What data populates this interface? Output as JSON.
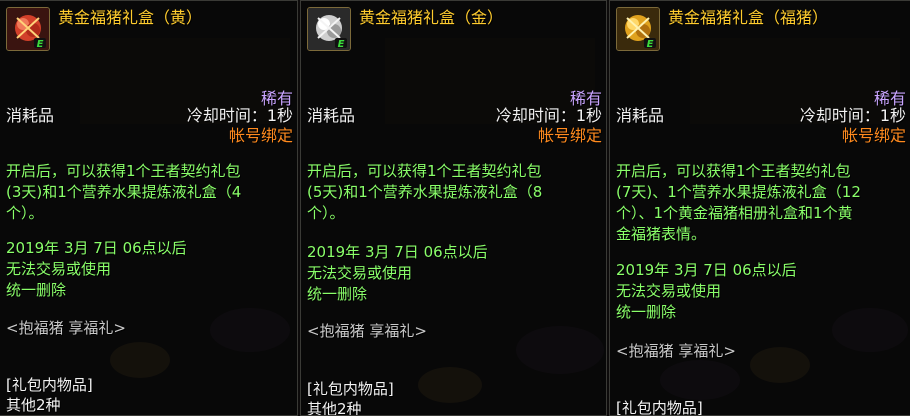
{
  "tooltips": [
    {
      "title": "黄金福猪礼盒（黄）",
      "icon": "gold-pig-gift-box-red-icon",
      "rarity": "稀有",
      "item_type": "消耗品",
      "cooldown": "冷却时间：1秒",
      "binding": "帐号绑定",
      "description_lines": [
        "开启后，可以获得1个王者契约礼包",
        "(3天)和1个营养水果提炼液礼盒（4",
        "个）。"
      ],
      "date_line": "2019年 3月 7日 06点以后",
      "trade_line": "无法交易或使用",
      "delete_line": "统一删除",
      "motto": "<抱福猪 享福礼>",
      "contents_heading": "[礼包内物品]",
      "contents_more": "其他2种"
    },
    {
      "title": "黄金福猪礼盒（金）",
      "icon": "gold-pig-gift-box-silver-icon",
      "rarity": "稀有",
      "item_type": "消耗品",
      "cooldown": "冷却时间：1秒",
      "binding": "帐号绑定",
      "description_lines": [
        "开启后，可以获得1个王者契约礼包",
        "(5天)和1个营养水果提炼液礼盒（8",
        "个）。"
      ],
      "date_line": "2019年 3月 7日 06点以后",
      "trade_line": "无法交易或使用",
      "delete_line": "统一删除",
      "motto": "<抱福猪 享福礼>",
      "contents_heading": "[礼包内物品]",
      "contents_more": "其他2种"
    },
    {
      "title": "黄金福猪礼盒（福猪）",
      "icon": "gold-pig-gift-box-gold-icon",
      "rarity": "稀有",
      "item_type": "消耗品",
      "cooldown": "冷却时间：1秒",
      "binding": "帐号绑定",
      "description_lines": [
        "开启后，可以获得1个王者契约礼包",
        "(7天)、1个营养水果提炼液礼盒（12",
        "个）、1个黄金福猪相册礼盒和1个黄",
        "金福猪表情。"
      ],
      "date_line": "2019年 3月 7日 06点以后",
      "trade_line": "无法交易或使用",
      "delete_line": "统一删除",
      "motto": "<抱福猪 享福礼>",
      "contents_heading": "[礼包内物品]"
    }
  ],
  "colors": {
    "title": "#ffcc2e",
    "rarity": "#c9a4ff",
    "binding": "#ff8a1e",
    "description": "#8aff6a",
    "text": "#f2f2f2",
    "motto": "#c9c9c9",
    "badge_e": "#3cdc3c"
  }
}
